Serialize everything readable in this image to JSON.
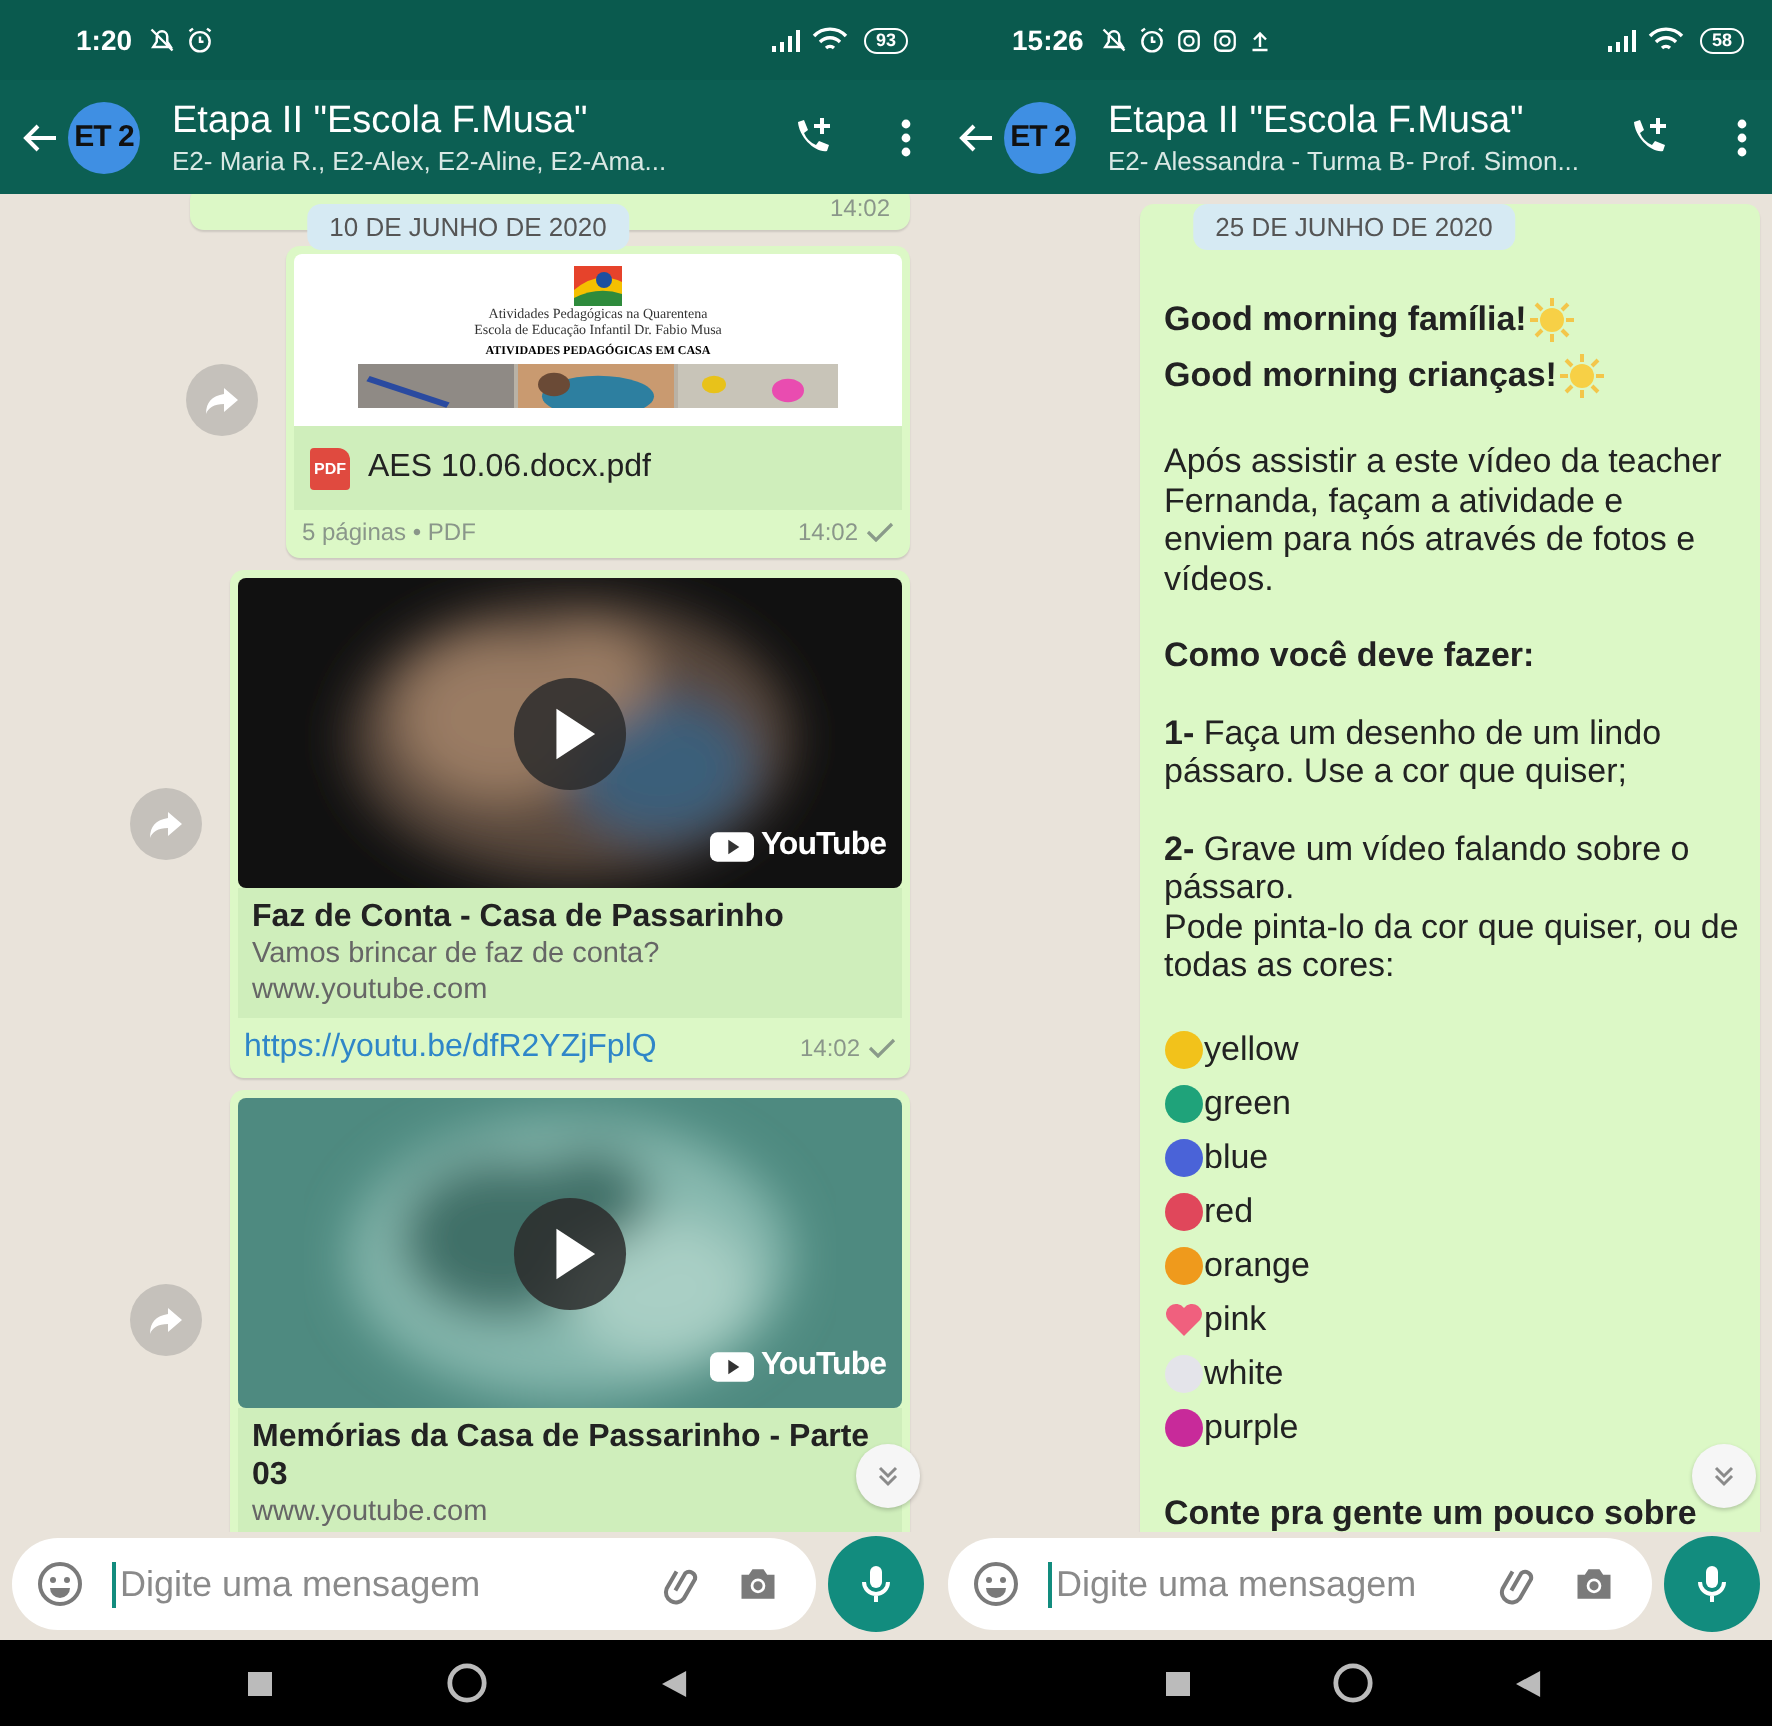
{
  "phones": [
    {
      "status_bar": {
        "time": "1:20",
        "battery": "93"
      },
      "header": {
        "avatar": "ET 2",
        "title": "Etapa II \"Escola F.Musa\"",
        "subtitle": "E2- Maria R., E2-Alex, E2-Aline, E2-Ama..."
      },
      "chat": {
        "date_chip": "10 DE JUNHO DE 2020",
        "scroll_button": true,
        "messages": [
          {
            "kind": "partial",
            "time": "14:02"
          },
          {
            "kind": "document",
            "forward_button": true,
            "preview": {
              "lines": [
                "Atividades Pedagógicas na Quarentena",
                "Escola de Educação Infantil Dr. Fabio Musa"
              ],
              "heading": "ATIVIDADES PEDAGÓGICAS EM CASA"
            },
            "file_badge": "PDF",
            "file_name": "AES 10.06.docx.pdf",
            "meta": "5 páginas • PDF",
            "time": "14:02",
            "sent": true
          },
          {
            "kind": "link",
            "forward_button": true,
            "badge": "YouTube",
            "title": "Faz de Conta - Casa de Passarinho",
            "description": "Vamos brincar de faz de conta?",
            "domain": "www.youtube.com",
            "url": "https://youtu.be/dfR2YZjFplQ",
            "time": "14:02",
            "sent": true
          },
          {
            "kind": "link",
            "forward_button": true,
            "badge": "YouTube",
            "title": "Memórias da Casa de Passarinho - Parte 03",
            "domain": "www.youtube.com"
          }
        ]
      },
      "input": {
        "placeholder": "Digite uma mensagem"
      }
    },
    {
      "status_bar": {
        "time": "15:26",
        "battery": "58"
      },
      "header": {
        "avatar": "ET 2",
        "title": "Etapa II \"Escola F.Musa\"",
        "subtitle": "E2- Alessandra - Turma B- Prof. Simon..."
      },
      "chat": {
        "date_chip": "25 DE JUNHO DE 2020",
        "scroll_button": true,
        "messages": [
          {
            "kind": "text",
            "forward_button": false,
            "groups": [
              [
                {
                  "kind": "greeting",
                  "text": "Good morning família!"
                },
                {
                  "kind": "greeting",
                  "text": "Good morning crianças!"
                }
              ],
              [
                {
                  "kind": "paragraph",
                  "text": "Após assistir a este vídeo da teacher Fernanda, façam a atividade e enviem para nós através de fotos e vídeos."
                }
              ],
              [
                {
                  "kind": "heading",
                  "text": "Como você deve fazer:"
                }
              ],
              [
                {
                  "kind": "paragraph",
                  "text": "**1-** Faça um desenho de um lindo pássaro. Use a cor que quiser;"
                }
              ],
              [
                {
                  "kind": "paragraph",
                  "text": "**2-** Grave um vídeo falando sobre o pássaro."
                },
                {
                  "kind": "paragraph",
                  "text": "Pode pinta-lo da cor que quiser, ou de todas as cores:"
                }
              ],
              [
                {
                  "kind": "swatch",
                  "text": "yellow",
                  "color": "#f2c21b"
                },
                {
                  "kind": "swatch",
                  "text": "green",
                  "color": "#1fa37a"
                },
                {
                  "kind": "swatch",
                  "text": "blue",
                  "color": "#4a63d8"
                },
                {
                  "kind": "swatch",
                  "text": "red",
                  "color": "#e0475b"
                },
                {
                  "kind": "swatch",
                  "text": "orange",
                  "color": "#ef9a1c"
                },
                {
                  "kind": "heart",
                  "text": "pink",
                  "color": "#f0607e"
                },
                {
                  "kind": "swatch",
                  "text": "white",
                  "color": "#e4e4ea"
                },
                {
                  "kind": "swatch",
                  "text": "purple",
                  "color": "#c82a9a"
                }
              ],
              [
                {
                  "kind": "heading",
                  "text": "Conte pra gente um pouco sobre"
                }
              ]
            ]
          }
        ]
      },
      "input": {
        "placeholder": "Digite uma mensagem"
      }
    }
  ]
}
